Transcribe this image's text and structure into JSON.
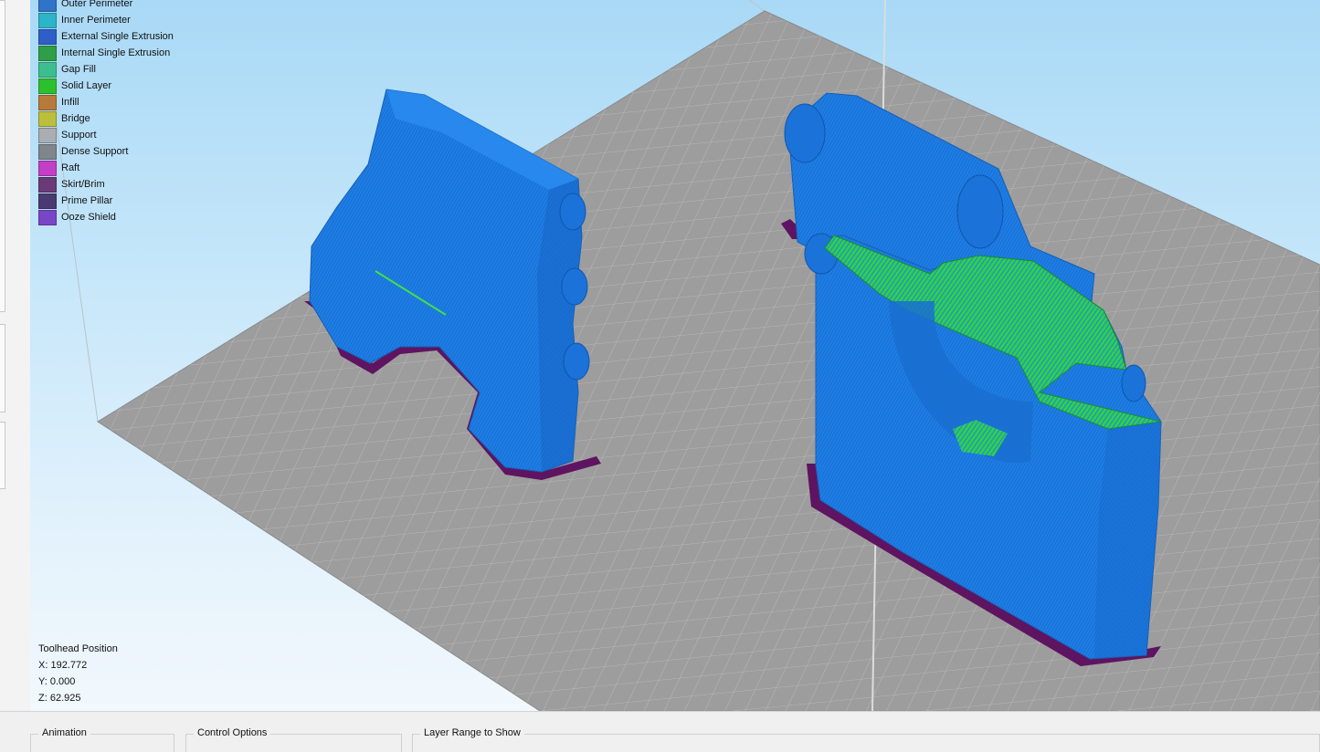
{
  "legend": {
    "items": [
      {
        "label": "Outer Perimeter",
        "color": "#2f74c8"
      },
      {
        "label": "Inner Perimeter",
        "color": "#2cb4c8"
      },
      {
        "label": "External Single Extrusion",
        "color": "#2e5fc9"
      },
      {
        "label": "Internal Single Extrusion",
        "color": "#2e9e48"
      },
      {
        "label": "Gap Fill",
        "color": "#3cbf8e"
      },
      {
        "label": "Solid Layer",
        "color": "#2cc02c"
      },
      {
        "label": "Infill",
        "color": "#b87a3a"
      },
      {
        "label": "Bridge",
        "color": "#bcbf3c"
      },
      {
        "label": "Support",
        "color": "#a8aeb2"
      },
      {
        "label": "Dense Support",
        "color": "#7e868c"
      },
      {
        "label": "Raft",
        "color": "#c23fc6"
      },
      {
        "label": "Skirt/Brim",
        "color": "#6a3a78"
      },
      {
        "label": "Prime Pillar",
        "color": "#4a3a72"
      },
      {
        "label": "Ooze Shield",
        "color": "#7a46c8"
      }
    ]
  },
  "toolhead": {
    "title": "Toolhead Position",
    "x_label": "X:",
    "x_value": "192.772",
    "y_label": "Y:",
    "y_value": "0.000",
    "z_label": "Z:",
    "z_value": "62.925"
  },
  "bottom_panel": {
    "animation_label": "Animation",
    "control_options_label": "Control Options",
    "layer_range_label": "Layer Range to Show"
  },
  "colors": {
    "print_blue": "#1f7de8",
    "solid_green": "#2fd62f",
    "brim_purple": "#5e1460",
    "bed_gray": "#9c9c9c"
  }
}
